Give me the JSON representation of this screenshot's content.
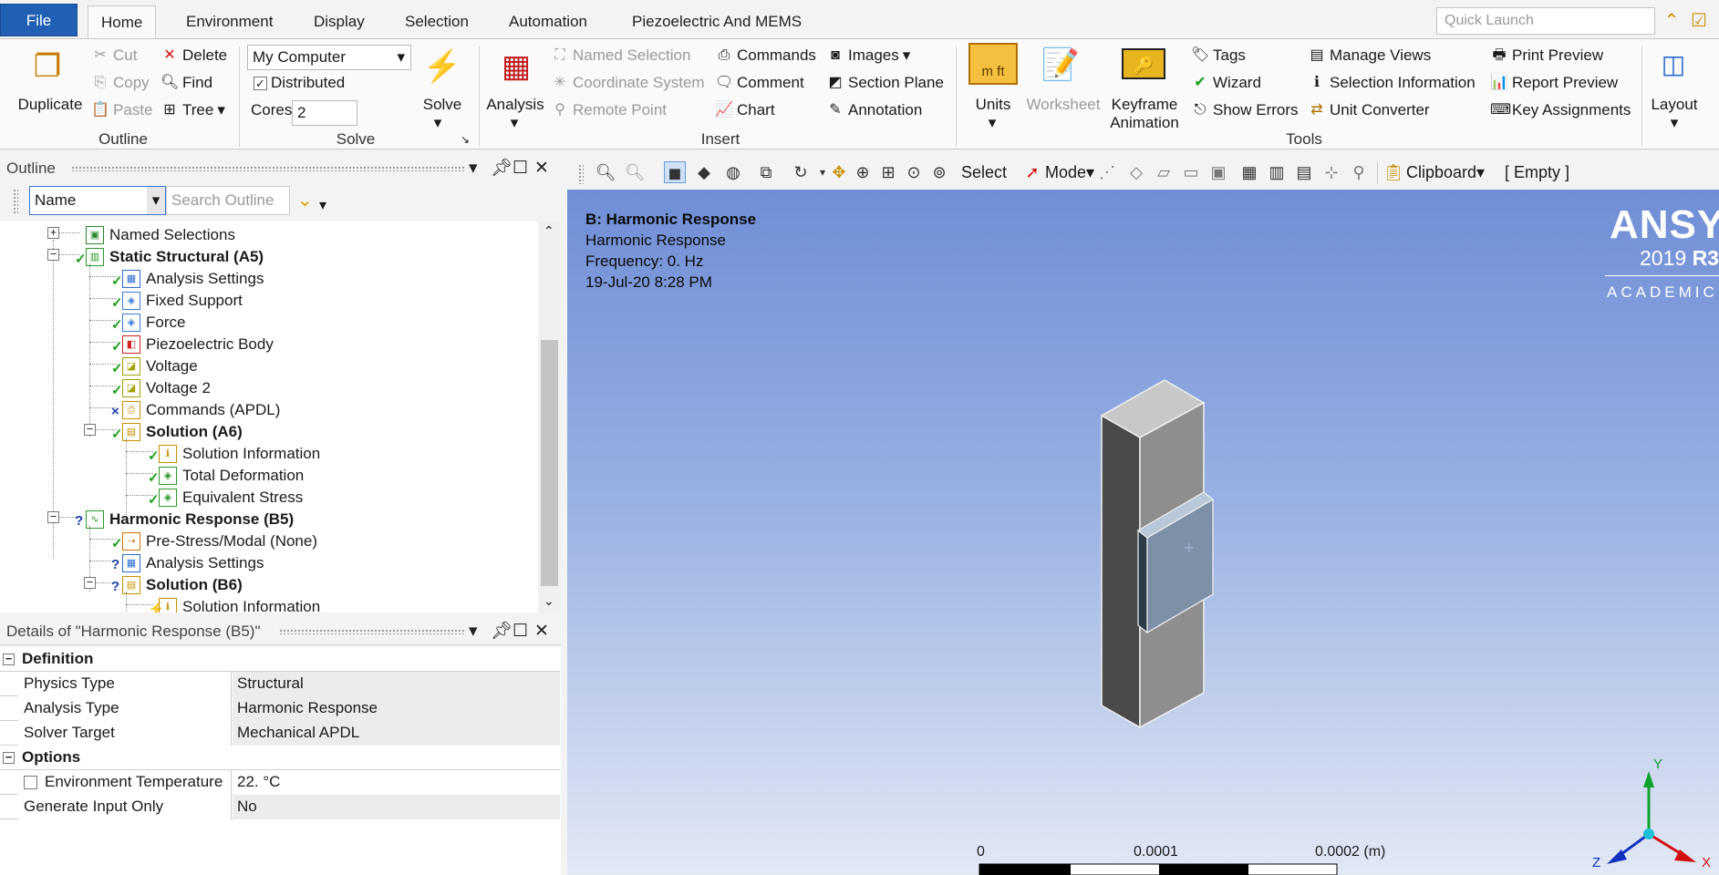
{
  "menu": {
    "file": "File",
    "tabs": [
      "Home",
      "Environment",
      "Display",
      "Selection",
      "Automation",
      "Piezoelectric And MEMS"
    ],
    "quick_launch_placeholder": "Quick Launch"
  },
  "ribbon": {
    "outline": {
      "duplicate": "Duplicate",
      "cut": "Cut",
      "copy": "Copy",
      "paste": "Paste",
      "delete": "Delete",
      "find": "Find",
      "tree": "Tree",
      "group": "Outline"
    },
    "solve": {
      "computer": "My Computer",
      "distributed": "Distributed",
      "cores_label": "Cores",
      "cores_value": "2",
      "solve": "Solve",
      "group": "Solve"
    },
    "insert": {
      "analysis": "Analysis",
      "named_selection": "Named Selection",
      "coordinate_system": "Coordinate System",
      "remote_point": "Remote Point",
      "commands": "Commands",
      "comment": "Comment",
      "chart": "Chart",
      "images": "Images",
      "section_plane": "Section Plane",
      "annotation": "Annotation",
      "group": "Insert"
    },
    "tools": {
      "units": "Units",
      "worksheet": "Worksheet",
      "keyframe1": "Keyframe",
      "keyframe2": "Animation",
      "tags": "Tags",
      "wizard": "Wizard",
      "show_errors": "Show Errors",
      "manage_views": "Manage Views",
      "selection_information": "Selection Information",
      "unit_converter": "Unit Converter",
      "print_preview": "Print Preview",
      "report_preview": "Report Preview",
      "key_assignments": "Key Assignments",
      "group": "Tools"
    },
    "layout": {
      "layout": "Layout"
    },
    "units_icon_text": "m ft"
  },
  "outline": {
    "title": "Outline",
    "filter_value": "Name",
    "search_placeholder": "Search Outline",
    "nodes": [
      {
        "label": "Named Selections",
        "status": ""
      },
      {
        "label": "Static Structural (A5)",
        "status": "✓"
      },
      {
        "label": "Analysis Settings",
        "status": "✓"
      },
      {
        "label": "Fixed Support",
        "status": "✓"
      },
      {
        "label": "Force",
        "status": "✓"
      },
      {
        "label": "Piezoelectric Body",
        "status": "✓"
      },
      {
        "label": "Voltage",
        "status": "✓"
      },
      {
        "label": "Voltage 2",
        "status": "✓"
      },
      {
        "label": "Commands (APDL)",
        "status": "×"
      },
      {
        "label": "Solution (A6)",
        "status": "✓"
      },
      {
        "label": "Solution Information",
        "status": "✓"
      },
      {
        "label": "Total Deformation",
        "status": "✓"
      },
      {
        "label": "Equivalent Stress",
        "status": "✓"
      },
      {
        "label": "Harmonic Response (B5)",
        "status": "?"
      },
      {
        "label": "Pre-Stress/Modal (None)",
        "status": "✓"
      },
      {
        "label": "Analysis Settings",
        "status": "?"
      },
      {
        "label": "Solution (B6)",
        "status": "?"
      },
      {
        "label": "Solution Information",
        "status": "⚡"
      }
    ]
  },
  "details": {
    "title": "Details of \"Harmonic Response (B5)\"",
    "categories": [
      {
        "name": "Definition",
        "rows": [
          [
            "Physics Type",
            "Structural"
          ],
          [
            "Analysis Type",
            "Harmonic Response"
          ],
          [
            "Solver Target",
            "Mechanical APDL"
          ]
        ]
      },
      {
        "name": "Options",
        "rows": [
          [
            "Environment Temperature",
            "22. °C"
          ],
          [
            "Generate Input Only",
            "No"
          ]
        ]
      }
    ]
  },
  "viewtoolbar": {
    "select": "Select",
    "mode": "Mode",
    "clipboard": "Clipboard",
    "empty": "[ Empty ]"
  },
  "viewport": {
    "title": "B: Harmonic Response",
    "subtitle": "Harmonic Response",
    "frequency": "Frequency: 0. Hz",
    "timestamp": "19-Jul-20 8:28 PM",
    "brand": "ANSYS",
    "version_prefix": "2019 ",
    "version_bold": "R3",
    "academic": "ACADEMIC",
    "scale": {
      "s0": "0",
      "s1": "0.0001",
      "s2": "0.0002 (m)"
    },
    "triad": {
      "x": "X",
      "y": "Y",
      "z": "Z"
    }
  },
  "colors": {
    "file_tab": "#1f5fb4",
    "check": "#1aa01a",
    "question": "#1a3faf",
    "lightning": "#e02020",
    "cross": "#1a3faf",
    "axis_x": "#d01010",
    "axis_y": "#10a030",
    "axis_z": "#1030c0"
  }
}
